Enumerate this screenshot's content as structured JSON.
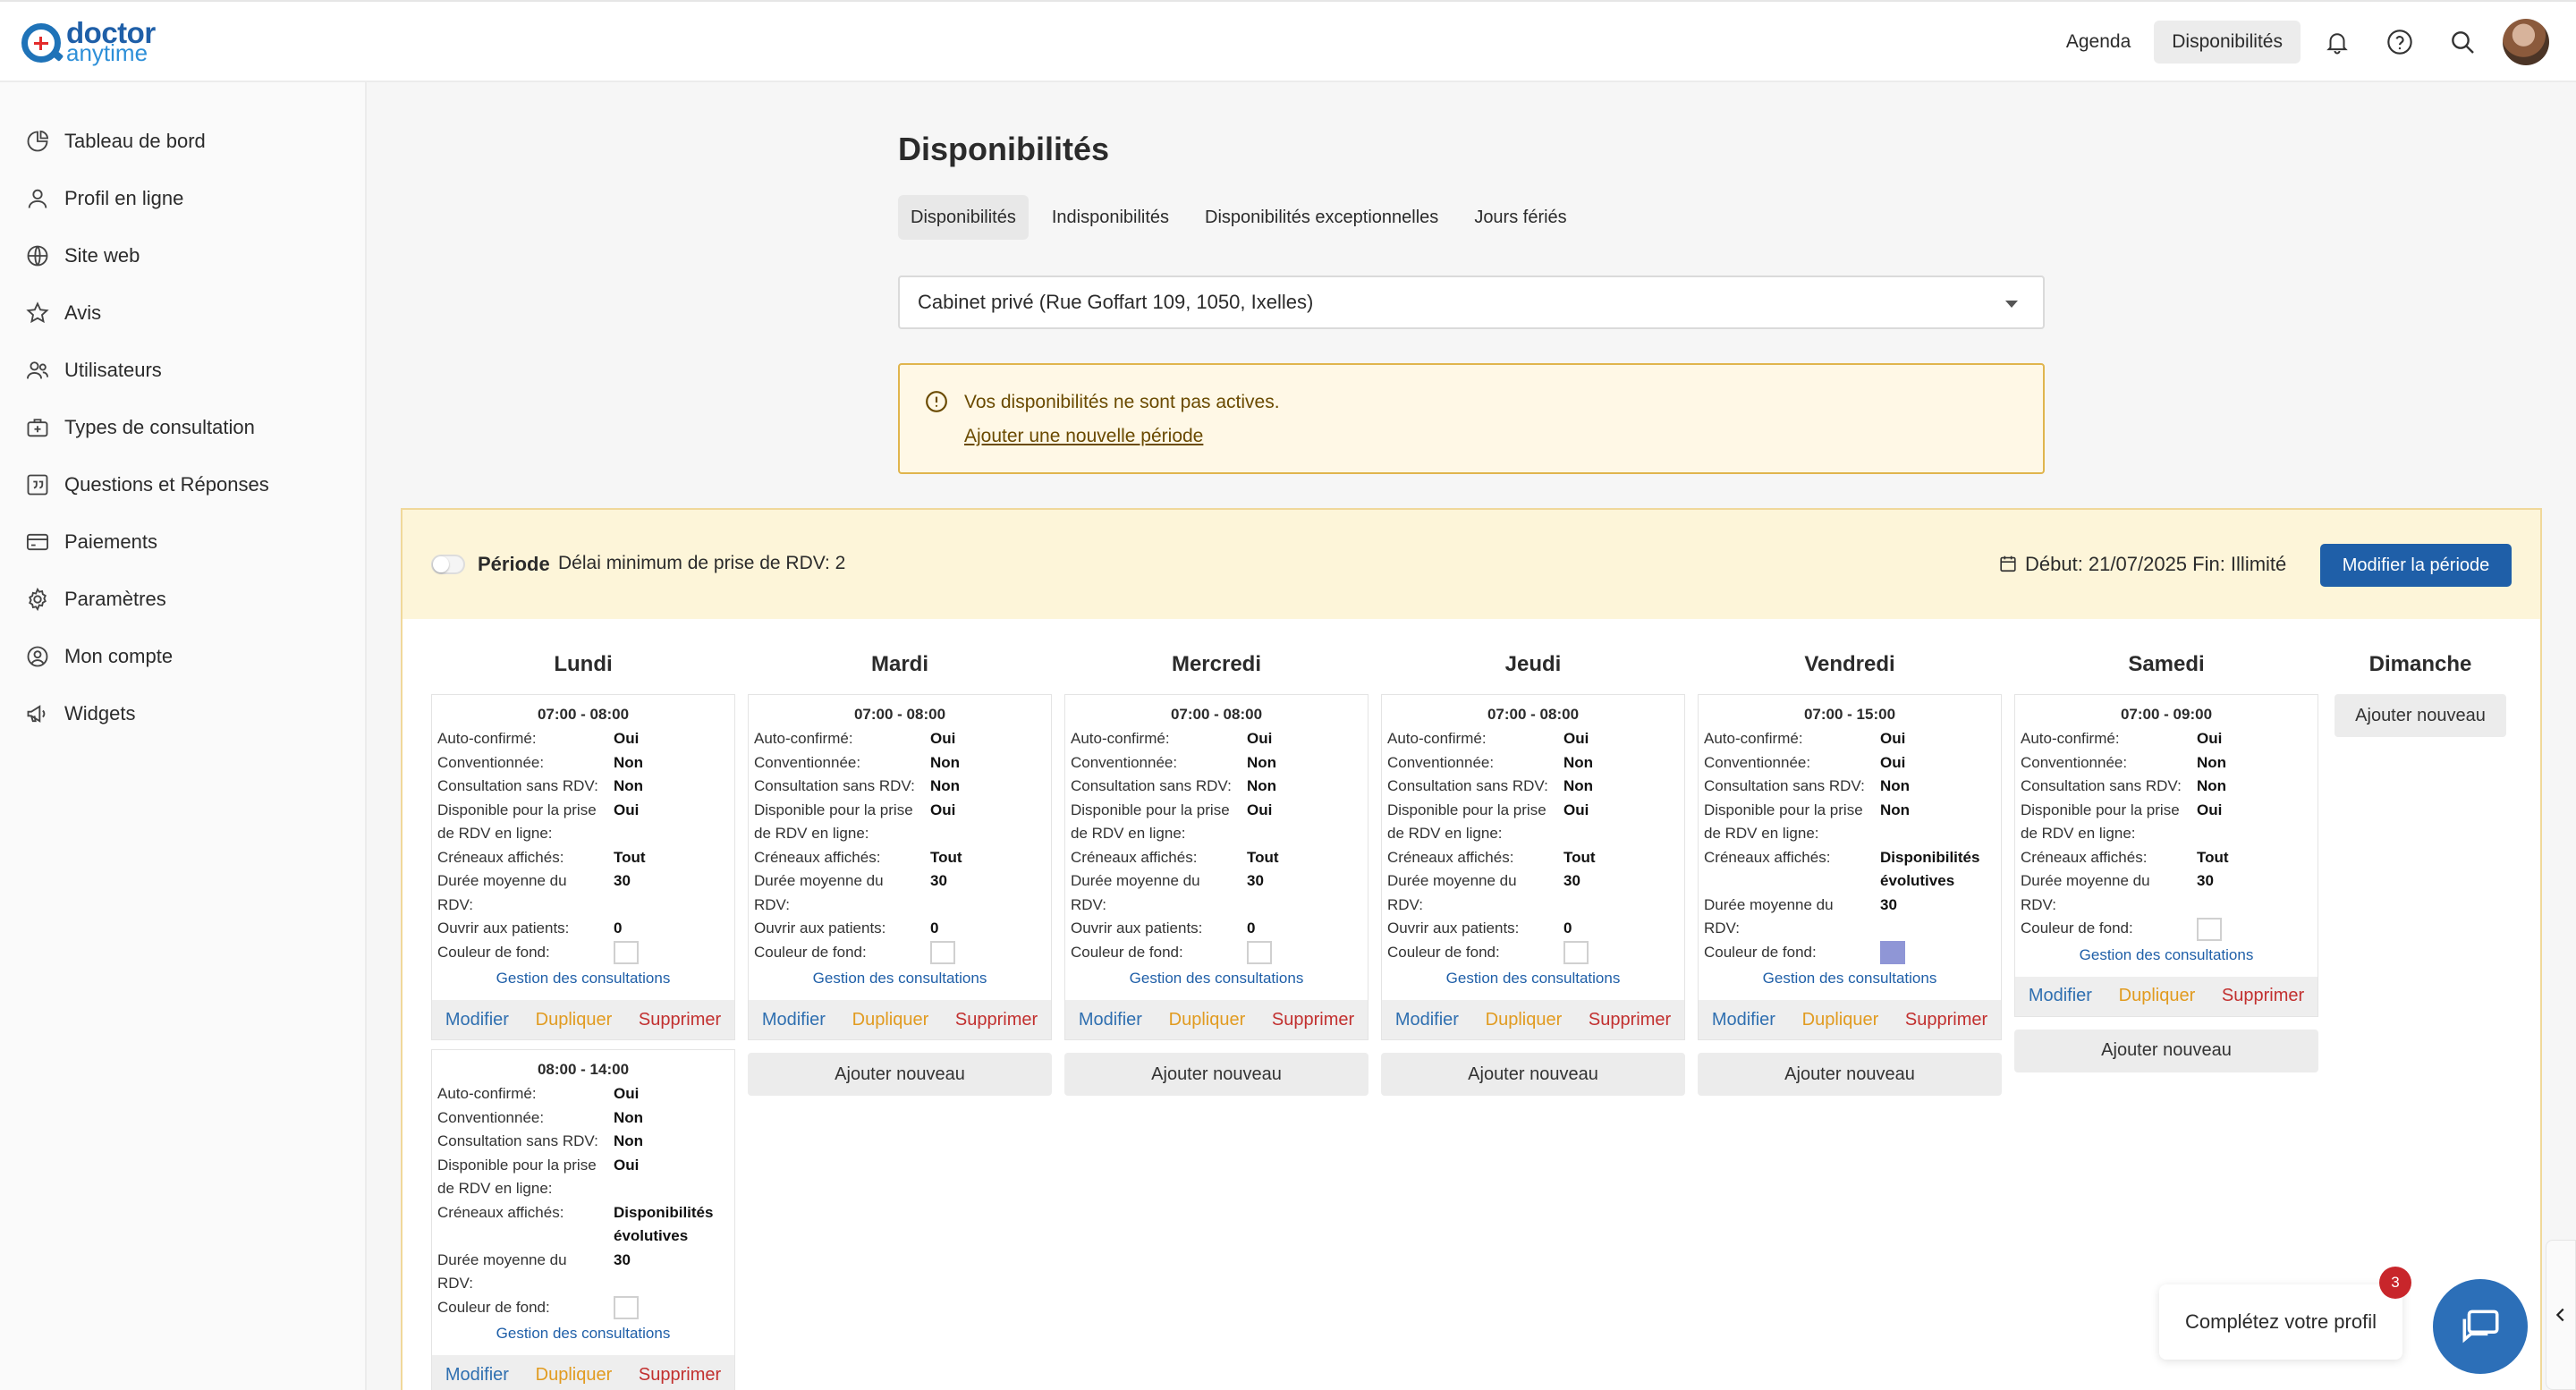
{
  "brand": {
    "name_primary": "doctor",
    "name_secondary": "anytime"
  },
  "topnav": {
    "agenda": "Agenda",
    "disponibilites": "Disponibilités"
  },
  "sidebar": {
    "items": [
      {
        "label": "Tableau de bord",
        "icon": "pie-chart-icon"
      },
      {
        "label": "Profil en ligne",
        "icon": "user-icon"
      },
      {
        "label": "Site web",
        "icon": "globe-icon"
      },
      {
        "label": "Avis",
        "icon": "star-icon"
      },
      {
        "label": "Utilisateurs",
        "icon": "users-icon"
      },
      {
        "label": "Types de consultation",
        "icon": "medical-bag-icon"
      },
      {
        "label": "Questions et Réponses",
        "icon": "quote-icon"
      },
      {
        "label": "Paiements",
        "icon": "credit-card-icon"
      },
      {
        "label": "Paramètres",
        "icon": "gear-icon"
      },
      {
        "label": "Mon compte",
        "icon": "account-circle-icon"
      },
      {
        "label": "Widgets",
        "icon": "megaphone-icon"
      }
    ]
  },
  "main": {
    "title": "Disponibilités",
    "tabs": [
      "Disponibilités",
      "Indisponibilités",
      "Disponibilités exceptionnelles",
      "Jours fériés"
    ],
    "location": "Cabinet privé (Rue Goffart 109, 1050, Ixelles)",
    "alert": {
      "message": "Vos disponibilités ne sont pas actives.",
      "link": "Ajouter une nouvelle période"
    }
  },
  "period": {
    "label": "Période",
    "delay": "Délai minimum de prise de RDV: 2",
    "dates": "Début: 21/07/2025 Fin: Illimité",
    "edit_button": "Modifier la période"
  },
  "labels": {
    "auto": "Auto-confirmé:",
    "conv": "Conventionnée:",
    "sans": "Consultation sans RDV:",
    "dispo_l1": "Disponible pour la prise",
    "dispo_l2": "de RDV en ligne:",
    "cren": "Créneaux affichés:",
    "duree_l1": "Durée moyenne du",
    "duree_l2": "RDV:",
    "ouvrir": "Ouvrir aux patients:",
    "couleur": "Couleur de fond:",
    "gestion": "Gestion des consultations",
    "modifier": "Modifier",
    "dupliquer": "Dupliquer",
    "supprimer": "Supprimer",
    "ajouter": "Ajouter nouveau"
  },
  "days": {
    "lundi": {
      "name": "Lundi",
      "slots": [
        {
          "time": "07:00 - 08:00",
          "auto": "Oui",
          "conv": "Non",
          "sans": "Non",
          "dispo": "Oui",
          "cren": "Tout",
          "duree": "30",
          "ouvrir": "0"
        },
        {
          "time": "08:00 - 14:00",
          "auto": "Oui",
          "conv": "Non",
          "sans": "Non",
          "dispo": "Oui",
          "cren_l1": "Disponibilités",
          "cren_l2": "évolutives",
          "duree": "30"
        }
      ]
    },
    "mardi": {
      "name": "Mardi",
      "slots": [
        {
          "time": "07:00 - 08:00",
          "auto": "Oui",
          "conv": "Non",
          "sans": "Non",
          "dispo": "Oui",
          "cren": "Tout",
          "duree": "30",
          "ouvrir": "0"
        }
      ]
    },
    "mercredi": {
      "name": "Mercredi",
      "slots": [
        {
          "time": "07:00 - 08:00",
          "auto": "Oui",
          "conv": "Non",
          "sans": "Non",
          "dispo": "Oui",
          "cren": "Tout",
          "duree": "30",
          "ouvrir": "0"
        }
      ]
    },
    "jeudi": {
      "name": "Jeudi",
      "slots": [
        {
          "time": "07:00 - 08:00",
          "auto": "Oui",
          "conv": "Non",
          "sans": "Non",
          "dispo": "Oui",
          "cren": "Tout",
          "duree": "30",
          "ouvrir": "0"
        }
      ]
    },
    "vendredi": {
      "name": "Vendredi",
      "slots": [
        {
          "time": "07:00 - 15:00",
          "auto": "Oui",
          "conv": "Oui",
          "sans": "Non",
          "dispo": "Non",
          "cren_l1": "Disponibilités",
          "cren_l2": "évolutives",
          "duree": "30",
          "color": "#8f96d6"
        }
      ]
    },
    "samedi": {
      "name": "Samedi",
      "slots": [
        {
          "time": "07:00 - 09:00",
          "auto": "Oui",
          "conv": "Non",
          "sans": "Non",
          "dispo": "Oui",
          "cren": "Tout",
          "duree": "30"
        }
      ]
    },
    "dimanche": {
      "name": "Dimanche",
      "slots": []
    }
  },
  "widgets": {
    "profile_prompt": "Complétez votre profil",
    "chat_badge": "3"
  },
  "colors": {
    "primary": "#1f5fa8",
    "alert_bg": "#fff8e6",
    "alert_border": "#e0b54e",
    "period_bg": "#fdf5d9",
    "duplicate": "#e19b20",
    "delete": "#c2302f"
  }
}
